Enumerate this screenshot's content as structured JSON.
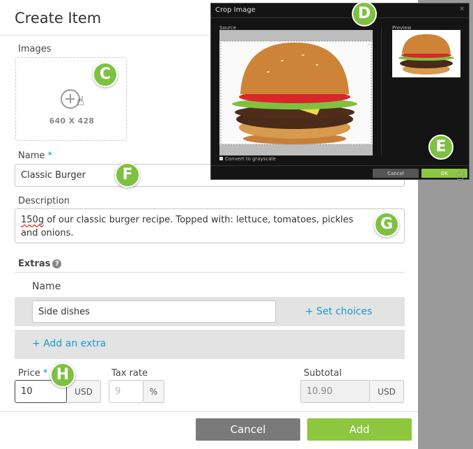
{
  "modal": {
    "title": "Create Item",
    "images_label": "Images",
    "upload_dims": "640 X 428",
    "name_label": "Name",
    "required_marker": "*",
    "name_value": "Classic Burger",
    "description_label": "Description",
    "description_first_word": "150g",
    "description_rest": " of our classic burger recipe. Topped with: lettuce, tomatoes, pickles and onions.",
    "extras_title": "Extras",
    "extras_help_icon": "question-circle-icon",
    "extras_name_header": "Name",
    "extra_name_value": "Side dishes",
    "set_choices_link": "+ Set choices",
    "add_extra_link": "+ Add an extra",
    "price_label": "Price",
    "price_value": "10",
    "price_currency": "USD",
    "tax_label": "Tax rate",
    "tax_placeholder": "9",
    "tax_unit": "%",
    "subtotal_label": "Subtotal",
    "subtotal_value": "10.90",
    "subtotal_currency": "USD",
    "cancel_label": "Cancel",
    "add_label": "Add"
  },
  "crop_dialog": {
    "title": "Crop Image",
    "close_glyph": "×",
    "source_label": "Source",
    "preview_label": "Preview",
    "grayscale_label": "Convert to grayscale",
    "cancel_label": "Cancel",
    "ok_label": "OK"
  },
  "badges": [
    "C",
    "D",
    "E",
    "F",
    "G",
    "H"
  ],
  "colors": {
    "accent_green": "#8dc63f",
    "link_blue": "#1a9ad6",
    "cancel_gray": "#7a7a7a",
    "badge_green": "#7ec142"
  }
}
